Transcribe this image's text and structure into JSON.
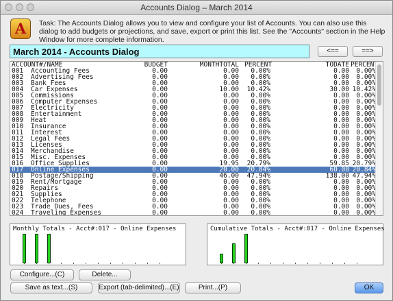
{
  "window": {
    "title": "Accounts Dialog – March 2014"
  },
  "logo_letter": "A",
  "task_text": "Task: The Accounts Dialog allows you to view and configure your list of Accounts. You can also use this dialog to add budgets or projections, and save, export or print this list. See the \"Accounts\" section in the Help Window for more complete information.",
  "header": {
    "title": "March 2014 - Accounts Dialog",
    "prev_label": "<==",
    "next_label": "==>"
  },
  "table": {
    "headers": [
      "ACCOUNT#/NAME",
      "BUDGET",
      "MONTHTOTAL",
      "PERCENT",
      "TODATE",
      "PERCENT"
    ],
    "rows": [
      [
        "001",
        "Accounting Fees",
        "0.00",
        "0.00",
        "0.00%",
        "0.00",
        "0.00%"
      ],
      [
        "002",
        "Advertising Fees",
        "0.00",
        "0.00",
        "0.00%",
        "0.00",
        "0.00%"
      ],
      [
        "003",
        "Bank Fees",
        "0.00",
        "0.00",
        "0.00%",
        "0.00",
        "0.00%"
      ],
      [
        "004",
        "Car Expenses",
        "0.00",
        "10.00",
        "10.42%",
        "30.00",
        "10.42%"
      ],
      [
        "005",
        "Commissions",
        "0.00",
        "0.00",
        "0.00%",
        "0.00",
        "0.00%"
      ],
      [
        "006",
        "Computer Expenses",
        "0.00",
        "0.00",
        "0.00%",
        "0.00",
        "0.00%"
      ],
      [
        "007",
        "Electricity",
        "0.00",
        "0.00",
        "0.00%",
        "0.00",
        "0.00%"
      ],
      [
        "008",
        "Entertainment",
        "0.00",
        "0.00",
        "0.00%",
        "0.00",
        "0.00%"
      ],
      [
        "009",
        "Heat",
        "0.00",
        "0.00",
        "0.00%",
        "0.00",
        "0.00%"
      ],
      [
        "010",
        "Insurance",
        "0.00",
        "0.00",
        "0.00%",
        "0.00",
        "0.00%"
      ],
      [
        "011",
        "Interest",
        "0.00",
        "0.00",
        "0.00%",
        "0.00",
        "0.00%"
      ],
      [
        "012",
        "Legal Fees",
        "0.00",
        "0.00",
        "0.00%",
        "0.00",
        "0.00%"
      ],
      [
        "013",
        "Licenses",
        "0.00",
        "0.00",
        "0.00%",
        "0.00",
        "0.00%"
      ],
      [
        "014",
        "Merchandise",
        "0.00",
        "0.00",
        "0.00%",
        "0.00",
        "0.00%"
      ],
      [
        "015",
        "Misc. Expenses",
        "0.00",
        "0.00",
        "0.00%",
        "0.00",
        "0.00%"
      ],
      [
        "016",
        "Office Supplies",
        "0.00",
        "19.95",
        "20.79%",
        "59.85",
        "20.79%"
      ],
      [
        "017",
        "Online Expenses",
        "0.00",
        "20.00",
        "20.84%",
        "60.00",
        "20.84%"
      ],
      [
        "018",
        "Postage/Shipping",
        "0.00",
        "46.00",
        "47.94%",
        "138.00",
        "47.94%"
      ],
      [
        "019",
        "Rent/Mortgage",
        "0.00",
        "0.00",
        "0.00%",
        "0.00",
        "0.00%"
      ],
      [
        "020",
        "Repairs",
        "0.00",
        "0.00",
        "0.00%",
        "0.00",
        "0.00%"
      ],
      [
        "021",
        "Supplies",
        "0.00",
        "0.00",
        "0.00%",
        "0.00",
        "0.00%"
      ],
      [
        "022",
        "Telephone",
        "0.00",
        "0.00",
        "0.00%",
        "0.00",
        "0.00%"
      ],
      [
        "023",
        "Trade Dues, Fees",
        "0.00",
        "0.00",
        "0.00%",
        "0.00",
        "0.00%"
      ],
      [
        "024",
        "Traveling Expenses",
        "0.00",
        "0.00",
        "0.00%",
        "0.00",
        "0.00%"
      ]
    ],
    "selected_index": 16
  },
  "monthly_chart": {
    "title": "Monthly Totals - Acct#:017 - Online Expenses",
    "values": [
      20,
      20,
      20,
      0,
      0,
      0,
      0,
      0,
      0,
      0,
      0,
      0
    ]
  },
  "cumulative_chart": {
    "title": "Cumulative Totals - Acct#:017 - Online Expenses",
    "values": [
      20,
      40,
      60,
      0,
      0,
      0,
      0,
      0,
      0,
      0,
      0,
      0
    ]
  },
  "buttons": {
    "configure": "Configure...(C)",
    "delete": "Delete...",
    "save_text": "Save as text...(S)",
    "export": "Export (tab-delimited)...(E)",
    "print": "Print...(P)",
    "ok": "OK"
  },
  "colors": {
    "header_bg": "#b5fafc",
    "selected_row": "#4d79b8",
    "bar_green": "#25d21d"
  }
}
